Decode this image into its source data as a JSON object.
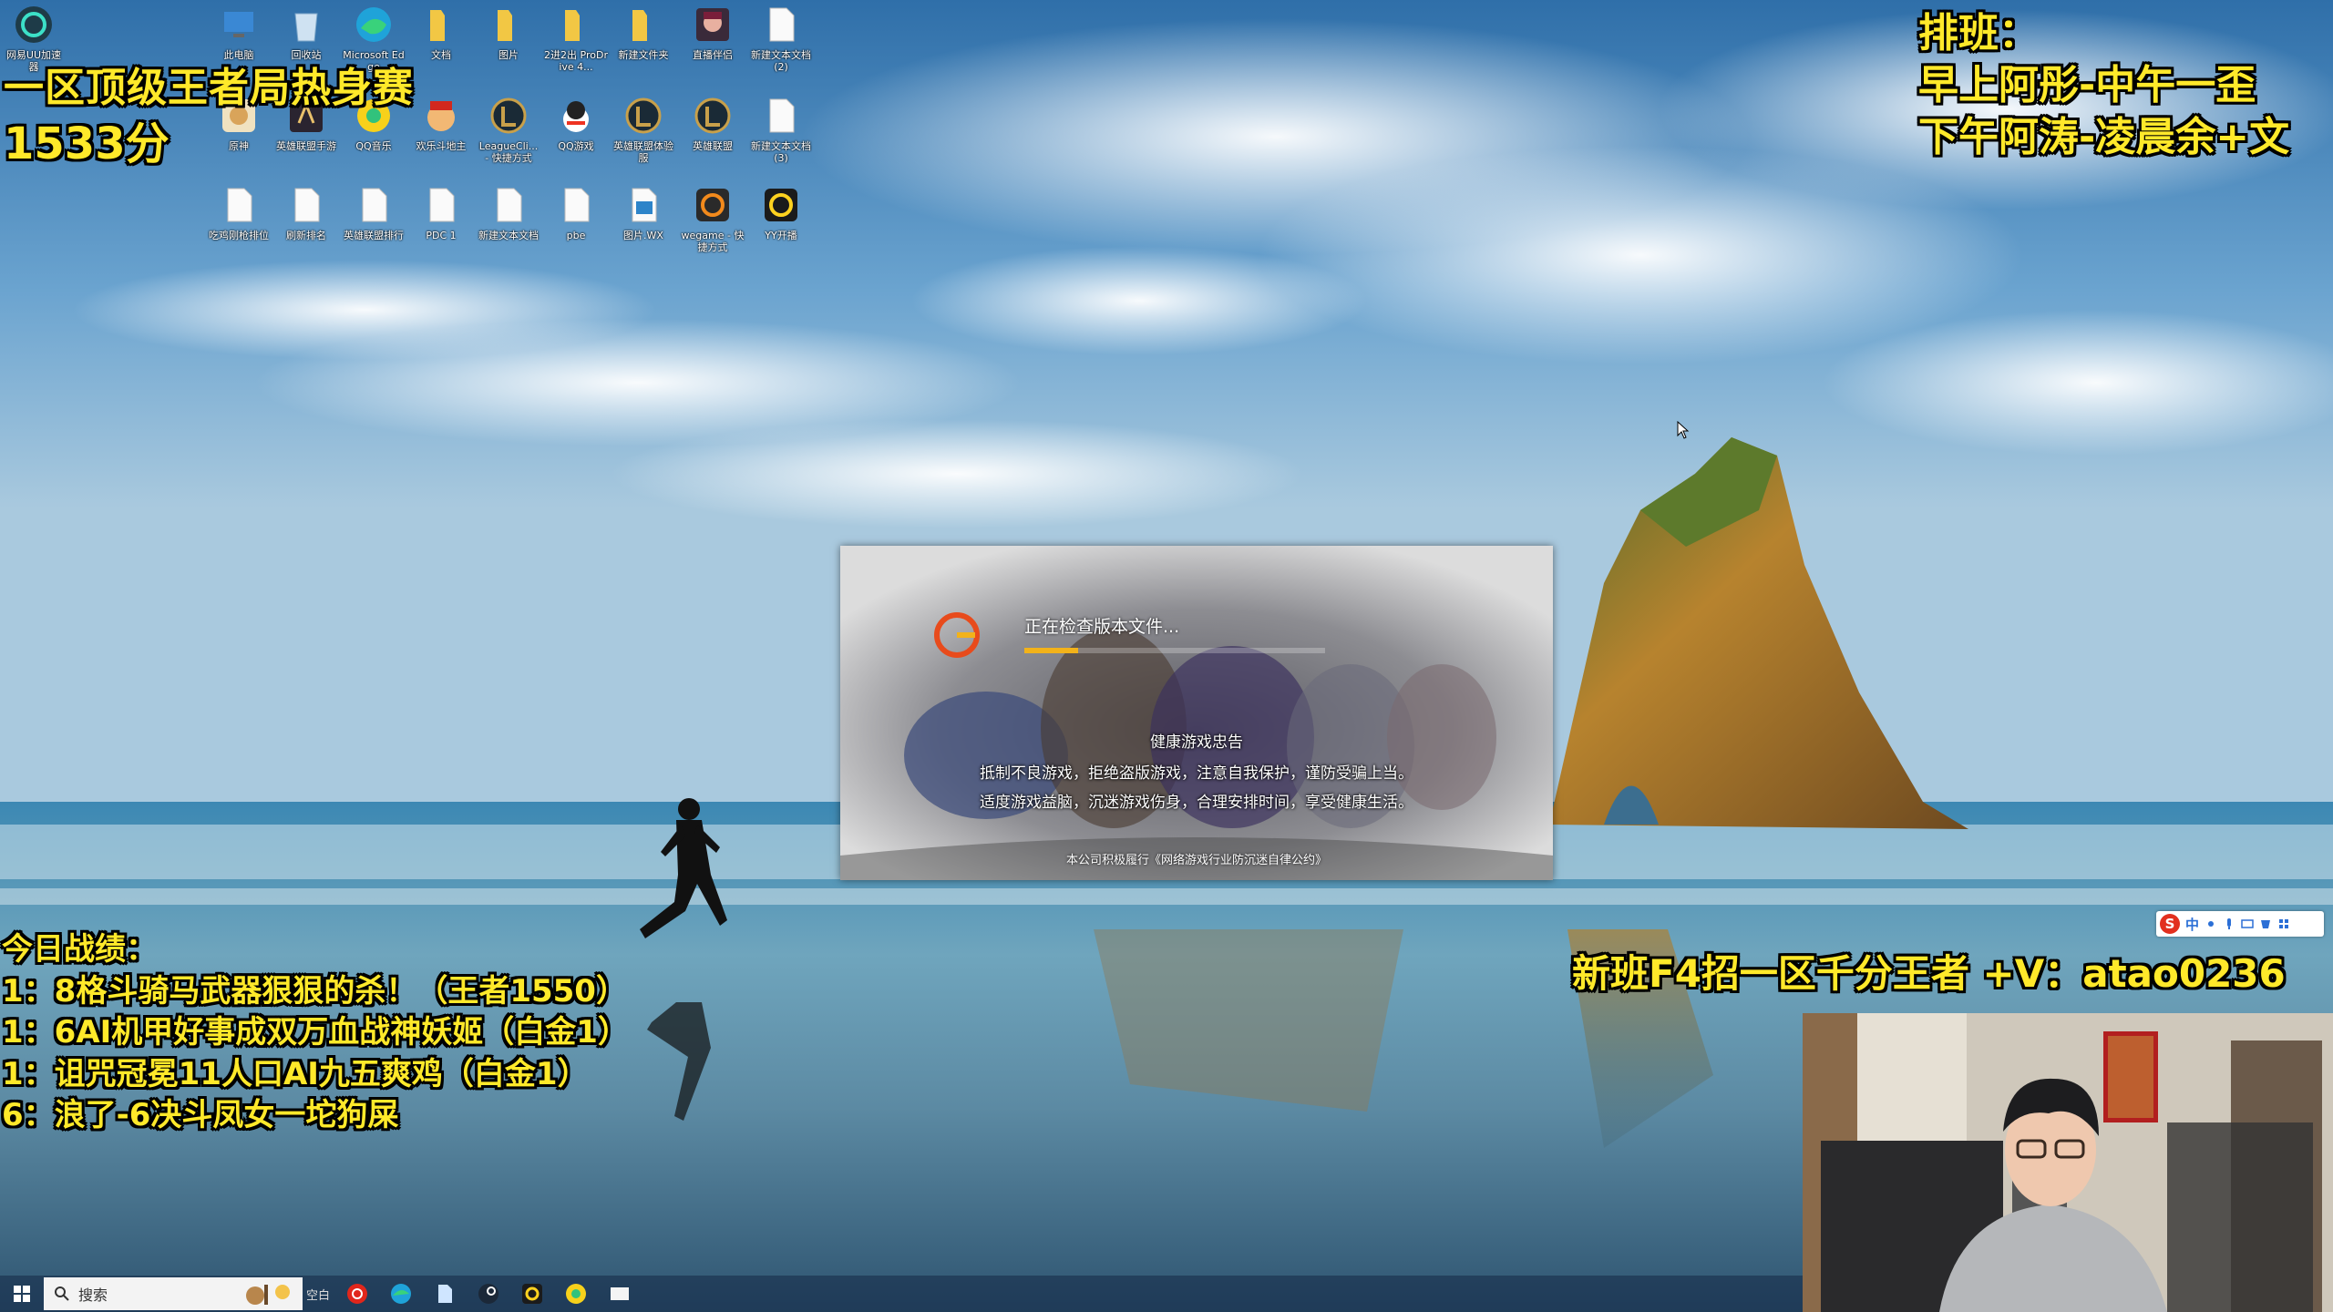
{
  "desktop": {
    "icons": [
      {
        "label": "网易UU加速器",
        "icon": "uu-accelerator-icon"
      },
      {
        "label": "此电脑",
        "icon": "this-pc-icon"
      },
      {
        "label": "回收站",
        "icon": "recycle-bin-icon"
      },
      {
        "label": "Microsoft Edge",
        "icon": "edge-icon"
      },
      {
        "label": "文档",
        "icon": "folder-icon"
      },
      {
        "label": "图片",
        "icon": "folder-icon"
      },
      {
        "label": "2进2出 ProDrive 4...",
        "icon": "folder-icon"
      },
      {
        "label": "新建文件夹",
        "icon": "folder-icon"
      },
      {
        "label": "直播伴侣",
        "icon": "anime-avatar-icon"
      },
      {
        "label": "新建文本文档 (2)",
        "icon": "text-file-icon"
      },
      {
        "label": "原神",
        "icon": "genshin-icon"
      },
      {
        "label": "英雄联盟手游",
        "icon": "game-a-icon"
      },
      {
        "label": "QQ音乐",
        "icon": "qq-music-icon"
      },
      {
        "label": "欢乐斗地主",
        "icon": "landlord-game-icon"
      },
      {
        "label": "LeagueCli... - 快捷方式",
        "icon": "league-icon"
      },
      {
        "label": "QQ游戏",
        "icon": "qq-game-icon"
      },
      {
        "label": "英雄联盟体验服",
        "icon": "league-icon"
      },
      {
        "label": "英雄联盟",
        "icon": "league-icon"
      },
      {
        "label": "新建文本文档 (3)",
        "icon": "text-file-icon"
      },
      {
        "label": "吃鸡刚枪排位",
        "icon": "text-file-icon"
      },
      {
        "label": "刷新排名",
        "icon": "text-file-icon"
      },
      {
        "label": "英雄联盟排行",
        "icon": "text-file-icon"
      },
      {
        "label": "PDC 1",
        "icon": "text-file-icon"
      },
      {
        "label": "新建文本文档",
        "icon": "text-file-icon"
      },
      {
        "label": "pbe",
        "icon": "text-file-icon"
      },
      {
        "label": "图片.WX",
        "icon": "image-file-icon"
      },
      {
        "label": "wegame - 快捷方式",
        "icon": "wegame-icon"
      },
      {
        "label": "YY开播",
        "icon": "yy-live-icon"
      }
    ]
  },
  "overlay": {
    "title": "一区顶级王者局热身赛",
    "score": "1533分",
    "schedule": {
      "heading": "排班：",
      "morning": "早上阿彤-中午一歪",
      "afternoon": "下午阿涛-凌晨余+文"
    },
    "results": {
      "heading": "今日战绩：",
      "lines": [
        "1：8格斗骑马武器狠狠的杀！（王者1550）",
        "1：6AI机甲好事成双万血战神妖姬（白金1）",
        "1：诅咒冠冕11人口AI九五爽鸡（白金1）",
        "6：浪了-6决斗凤女一坨狗屎"
      ]
    },
    "ad": "新班F4招一区千分王者 +V：atao0236"
  },
  "launcher": {
    "status": "正在检查版本文件...",
    "progress": 0.18,
    "health_title": "健康游戏忠告",
    "health_line1": "抵制不良游戏，拒绝盗版游戏，注意自我保护，谨防受骗上当。",
    "health_line2": "适度游戏益脑，沉迷游戏伤身，合理安排时间，享受健康生活。",
    "pledge": "本公司积极履行《网络游戏行业防沉迷自律公约》",
    "colors": {
      "accent": "#f2b21a",
      "logo": "#e84b1c"
    }
  },
  "taskbar": {
    "search_placeholder": "搜索",
    "label": "空白",
    "apps": [
      "netease-music-icon",
      "edge-icon",
      "file-icon",
      "steam-icon",
      "yy-live-icon",
      "qq-music-icon",
      "file-explorer-icon"
    ]
  },
  "ime": {
    "mode": "中"
  }
}
